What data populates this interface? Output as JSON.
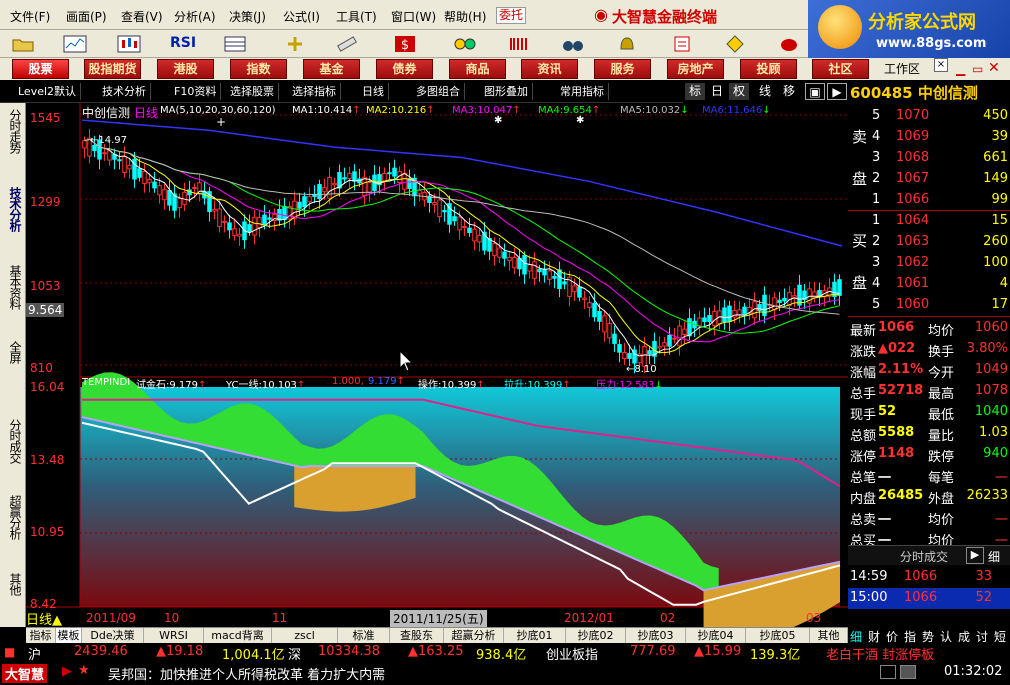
{
  "menu": [
    "文件(F)",
    "画面(P)",
    "查看(V)",
    "分析(A)",
    "决策(J)",
    "公式(I)",
    "工具(T)",
    "窗口(W)",
    "帮助(H)"
  ],
  "delegate_label": "委托",
  "brand_title": "大智慧金融终端",
  "logo": {
    "title": "分析家公式网",
    "url": "www.88gs.com"
  },
  "nav": [
    "股票",
    "股指期货",
    "港股",
    "指数",
    "基金",
    "债券",
    "商品",
    "资讯",
    "服务",
    "房地产",
    "投顾",
    "社区"
  ],
  "workspace_label": "工作区",
  "subbar": [
    "Level2默认",
    "技术分析",
    "F10资料",
    "选择股票",
    "选择指标",
    "日线",
    "多图组合",
    "图形叠加",
    "常用指标"
  ],
  "right_tabs": [
    "标",
    "日",
    "权",
    "线",
    "移"
  ],
  "side_tabs": [
    "分时走势",
    "技术分析",
    "基本资料",
    "全屏",
    "分时成交",
    "超赢分析",
    "其他"
  ],
  "chart": {
    "title": "中创信测",
    "period": "日线",
    "ma_header": "MA(5,10,20,30,60,120)",
    "ma": [
      {
        "label": "MA1:",
        "value": "10.414",
        "arrow": "↑",
        "color": "#ffffff"
      },
      {
        "label": "MA2:",
        "value": "10.216",
        "arrow": "↑",
        "color": "#ffff00"
      },
      {
        "label": "MA3:",
        "value": "10.047",
        "arrow": "↑",
        "color": "#ff00ff"
      },
      {
        "label": "MA4:",
        "value": "9.654",
        "arrow": "↑",
        "color": "#00ff00"
      },
      {
        "label": "MA5:",
        "value": "10.032",
        "arrow": "↓",
        "color": "#bbbbbb"
      },
      {
        "label": "MA6:",
        "value": "11.646",
        "arrow": "↓",
        "color": "#3333ff"
      }
    ],
    "y_labels": [
      "1545",
      "1299",
      "1053",
      "810"
    ],
    "cursor_value": "9.564",
    "high_mark": "14.97",
    "low_mark": "8.10",
    "lower_title": "TEMPINDI",
    "lower_items": [
      {
        "label": "试金石:",
        "value": "9.179",
        "arrow": "↑",
        "color": "#ffffff"
      },
      {
        "label": "YC一线:",
        "value": "10.103",
        "arrow": "↑",
        "color": "#ffffff"
      },
      {
        "label": "",
        "value": "1.000,",
        "arrow": "",
        "color": "#ff3030"
      },
      {
        "label": "",
        "value": "9.179",
        "arrow": "↑",
        "color": "#3366ff"
      },
      {
        "label": "操作:",
        "value": "10.399",
        "arrow": "↑",
        "color": "#ffffff"
      },
      {
        "label": "拉升:",
        "value": "10.399",
        "arrow": "↑",
        "color": "#00ffff"
      },
      {
        "label": "压力:",
        "value": "12.583",
        "arrow": "↓",
        "color": "#ff00ff"
      }
    ],
    "lower_y_labels": [
      "16.04",
      "13.48",
      "10.95",
      "8.42"
    ],
    "x_labels": [
      "2011/09",
      "10",
      "11",
      "2011/11/25(五)",
      "2012/01",
      "02",
      "03"
    ],
    "period_tag": "日线"
  },
  "chart_data": {
    "type": "line",
    "x": [
      "2011/09",
      "2011/10",
      "2011/11",
      "2011/12",
      "2012/01",
      "2012/02",
      "2012/03"
    ],
    "series": [
      {
        "name": "MA6",
        "values": [
          15.3,
          15.0,
          14.5,
          14.2,
          13.5,
          12.6,
          11.6
        ]
      },
      {
        "name": "压力",
        "values": [
          15.6,
          15.5,
          15.5,
          14.8,
          14.1,
          13.4,
          12.6
        ]
      }
    ],
    "ylim": [
      8.1,
      15.45
    ]
  },
  "quote": {
    "code": "600485",
    "name": "中创信测",
    "sell_label": [
      "卖",
      "盘"
    ],
    "buy_label": [
      "买",
      "盘"
    ],
    "sell": [
      [
        "5",
        "1070",
        "450"
      ],
      [
        "4",
        "1069",
        "39"
      ],
      [
        "3",
        "1068",
        "661"
      ],
      [
        "2",
        "1067",
        "149"
      ],
      [
        "1",
        "1066",
        "99"
      ]
    ],
    "buy": [
      [
        "1",
        "1064",
        "15"
      ],
      [
        "2",
        "1063",
        "260"
      ],
      [
        "3",
        "1062",
        "100"
      ],
      [
        "4",
        "1061",
        "4"
      ],
      [
        "5",
        "1060",
        "17"
      ]
    ],
    "stats": [
      [
        "最新",
        "1066",
        "均价",
        "1060"
      ],
      [
        "涨跌",
        "▲022",
        "换手",
        "3.80%"
      ],
      [
        "涨幅",
        "2.11%",
        "今开",
        "1049"
      ],
      [
        "总手",
        "52718",
        "最高",
        "1078"
      ],
      [
        "现手",
        "52",
        "最低",
        "1040"
      ],
      [
        "总额",
        "5588",
        "量比",
        "1.03"
      ],
      [
        "涨停",
        "1148",
        "跌停",
        "940"
      ],
      [
        "总笔",
        "一",
        "每笔",
        "一"
      ],
      [
        "内盘",
        "26485",
        "外盘",
        "26233"
      ],
      [
        "总卖",
        "一",
        "均价",
        "一"
      ],
      [
        "总买",
        "一",
        "均价",
        "一"
      ]
    ],
    "trades_title": "分时成交",
    "trades": [
      [
        "14:59",
        "1066",
        "33"
      ],
      [
        "15:00",
        "1066",
        "52"
      ]
    ],
    "tabs": [
      "细",
      "财",
      "价",
      "指",
      "势",
      "认",
      "成",
      "讨",
      "短"
    ]
  },
  "bottom_tabs": [
    "指标",
    "模板",
    "Dde决策",
    "WRSI",
    "macd背离",
    "zscl",
    "标准",
    "查股东",
    "超赢分析",
    "抄底01",
    "抄底02",
    "抄底03",
    "抄底04",
    "抄底05",
    "其他"
  ],
  "ticker": {
    "sh": "沪",
    "sh_index": "2439.46",
    "sh_change": "▲19.18",
    "sh_amount": "1,004.1亿",
    "sz": "深",
    "sz_index": "10334.38",
    "sz_change": "▲163.25",
    "sz_amount": "938.4亿",
    "board": "创业板指",
    "board_index": "777.69",
    "board_change": "▲15.99",
    "board_amount": "139.3亿",
    "hot": "老白干酒 封涨停板"
  },
  "news": {
    "app": "大智慧",
    "text": "吴邦国：加快推进个人所得税改革 着力扩大内需",
    "time": "01:32:02"
  }
}
